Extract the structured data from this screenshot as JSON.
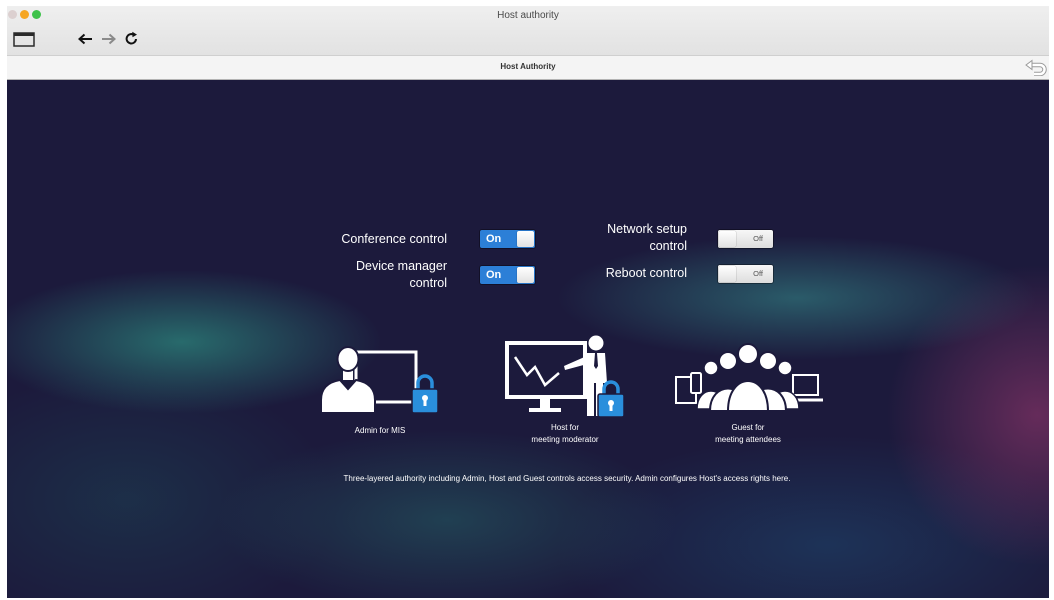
{
  "window": {
    "title": "Host authority",
    "traffic_lights": {
      "close": "#dcd0d0",
      "minimize": "#f6a623",
      "zoom": "#3ec24a"
    }
  },
  "toolbar": {
    "icons": {
      "sidebar": "window-icon",
      "back": "back-arrow-icon",
      "forward": "forward-arrow-icon",
      "reload": "reload-icon"
    },
    "forward_enabled": false
  },
  "navbar": {
    "title": "Host Authority",
    "return_icon": "return-arrow-icon"
  },
  "controls": [
    {
      "label_lines": [
        "Conference control"
      ],
      "state": "On",
      "on": true
    },
    {
      "label_lines": [
        "Device manager",
        "control"
      ],
      "state": "On",
      "on": true
    },
    {
      "label_lines": [
        "Network setup",
        "control"
      ],
      "state": "Off",
      "on": false
    },
    {
      "label_lines": [
        "Reboot control"
      ],
      "state": "Off",
      "on": false
    }
  ],
  "roles": [
    {
      "icon": "admin-board-lock-icon",
      "label_lines": [
        "Admin for MIS"
      ]
    },
    {
      "icon": "host-presenter-lock-icon",
      "label_lines": [
        "Host for",
        "meeting moderator"
      ]
    },
    {
      "icon": "guest-attendees-icon",
      "label_lines": [
        "Guest for",
        "meeting attendees"
      ]
    }
  ],
  "description": "Three-layered authority including Admin, Host and Guest controls access security. Admin configures Host's access rights here.",
  "colors": {
    "background": "#1c1a3c",
    "toggle_on": "#2c7fd7",
    "lock": "#2a8fdc",
    "text": "#ffffff"
  }
}
